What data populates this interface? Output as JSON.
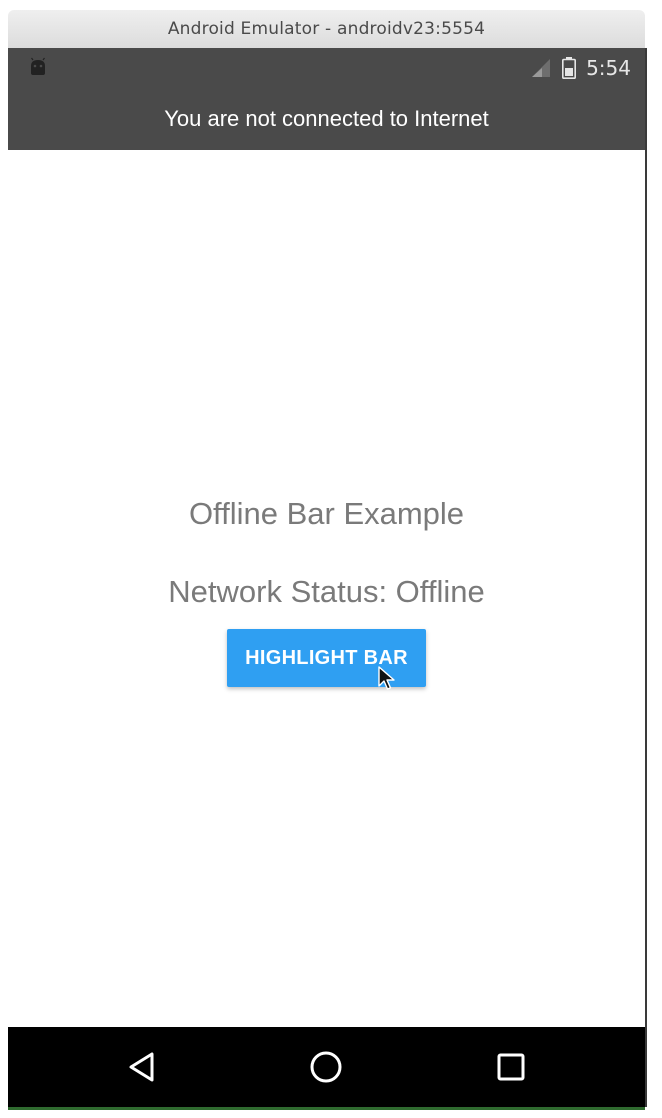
{
  "window": {
    "title": "Android Emulator - androidv23:5554"
  },
  "status_bar": {
    "time": "5:54",
    "icons": [
      "android-icon",
      "signal-icon",
      "battery-icon"
    ]
  },
  "offline_bar": {
    "message": "You are not connected to Internet",
    "background_color": "#4a4a4a"
  },
  "main": {
    "title": "Offline Bar Example",
    "network_status": "Network Status: Offline",
    "highlight_button_label": "HIGHLIGHT BAR",
    "button_color": "#2f9ff2"
  },
  "nav_bar": {
    "buttons": [
      "back-icon",
      "home-icon",
      "recents-icon"
    ]
  }
}
